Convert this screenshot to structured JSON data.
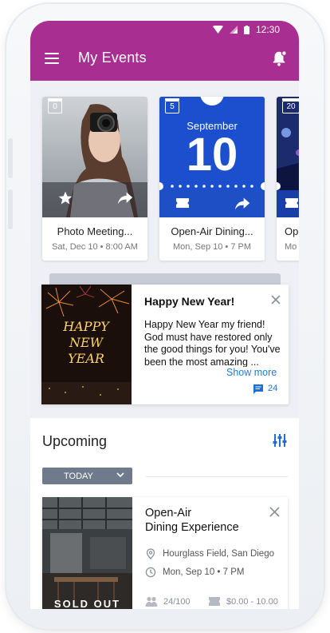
{
  "status_bar": {
    "time": "12:30"
  },
  "app_bar": {
    "title": "My Events"
  },
  "event_cards": [
    {
      "title": "Photo Meeting...",
      "subtitle": "Sat, Dec 10  •  8:00 AM",
      "date_badge": "0"
    },
    {
      "title": "Open-Air Dining...",
      "subtitle": "Mon, Sep 10  •  7 PM",
      "date_badge": "5",
      "month": "September",
      "day": "10"
    },
    {
      "title": "Op",
      "subtitle": "Mo",
      "date_badge": "20"
    }
  ],
  "feed_post": {
    "title": "Happy New Year!",
    "body": "Happy New Year my friend! God must have restored only the good things for you! You've been the most amazing ...",
    "show_more": "Show more",
    "comment_count": "24",
    "image_text": "HAPPY NEW YEAR"
  },
  "upcoming": {
    "title": "Upcoming",
    "filter_label": "TODAY",
    "event": {
      "title": "Open-Air\nDining Experience",
      "location": "Hourglass Field, San Diego",
      "datetime": "Mon, Sep 10  •  7 PM",
      "attendance": "24/100",
      "price": "$0.00 - 10.00",
      "badge": "SOLD OUT"
    }
  },
  "colors": {
    "primary": "#a82f91",
    "accent_blue": "#1e4fc5",
    "link": "#1e7be0"
  }
}
